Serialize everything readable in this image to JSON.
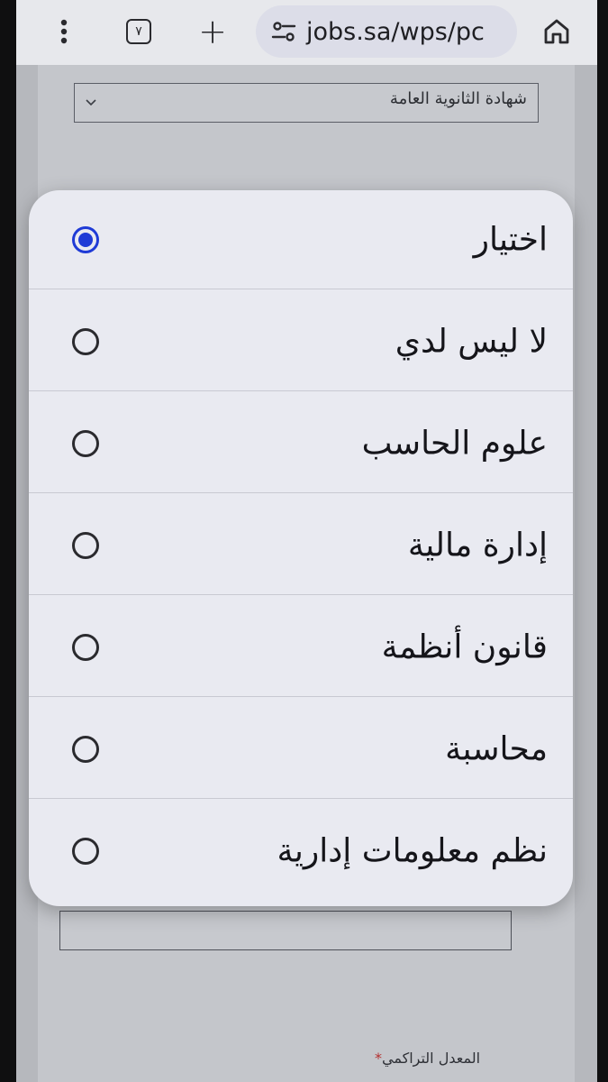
{
  "browser": {
    "url": "jobs.sa/wps/pc",
    "tab_count": "٧",
    "new_tab_label": "+"
  },
  "form": {
    "qualification_value": "شهادة الثانوية العامة",
    "gpa_label": "المعدل التراكمي",
    "required_marker": "*"
  },
  "popup": {
    "options": [
      {
        "label": "اختيار",
        "selected": true
      },
      {
        "label": "لا ليس لدي",
        "selected": false
      },
      {
        "label": "علوم الحاسب",
        "selected": false
      },
      {
        "label": "إدارة مالية",
        "selected": false
      },
      {
        "label": "قانون أنظمة",
        "selected": false
      },
      {
        "label": "محاسبة",
        "selected": false
      },
      {
        "label": "نظم معلومات إدارية",
        "selected": false
      }
    ]
  },
  "colors": {
    "accent_radio": "#1f3bd6",
    "popup_bg": "#e9eaf1"
  }
}
